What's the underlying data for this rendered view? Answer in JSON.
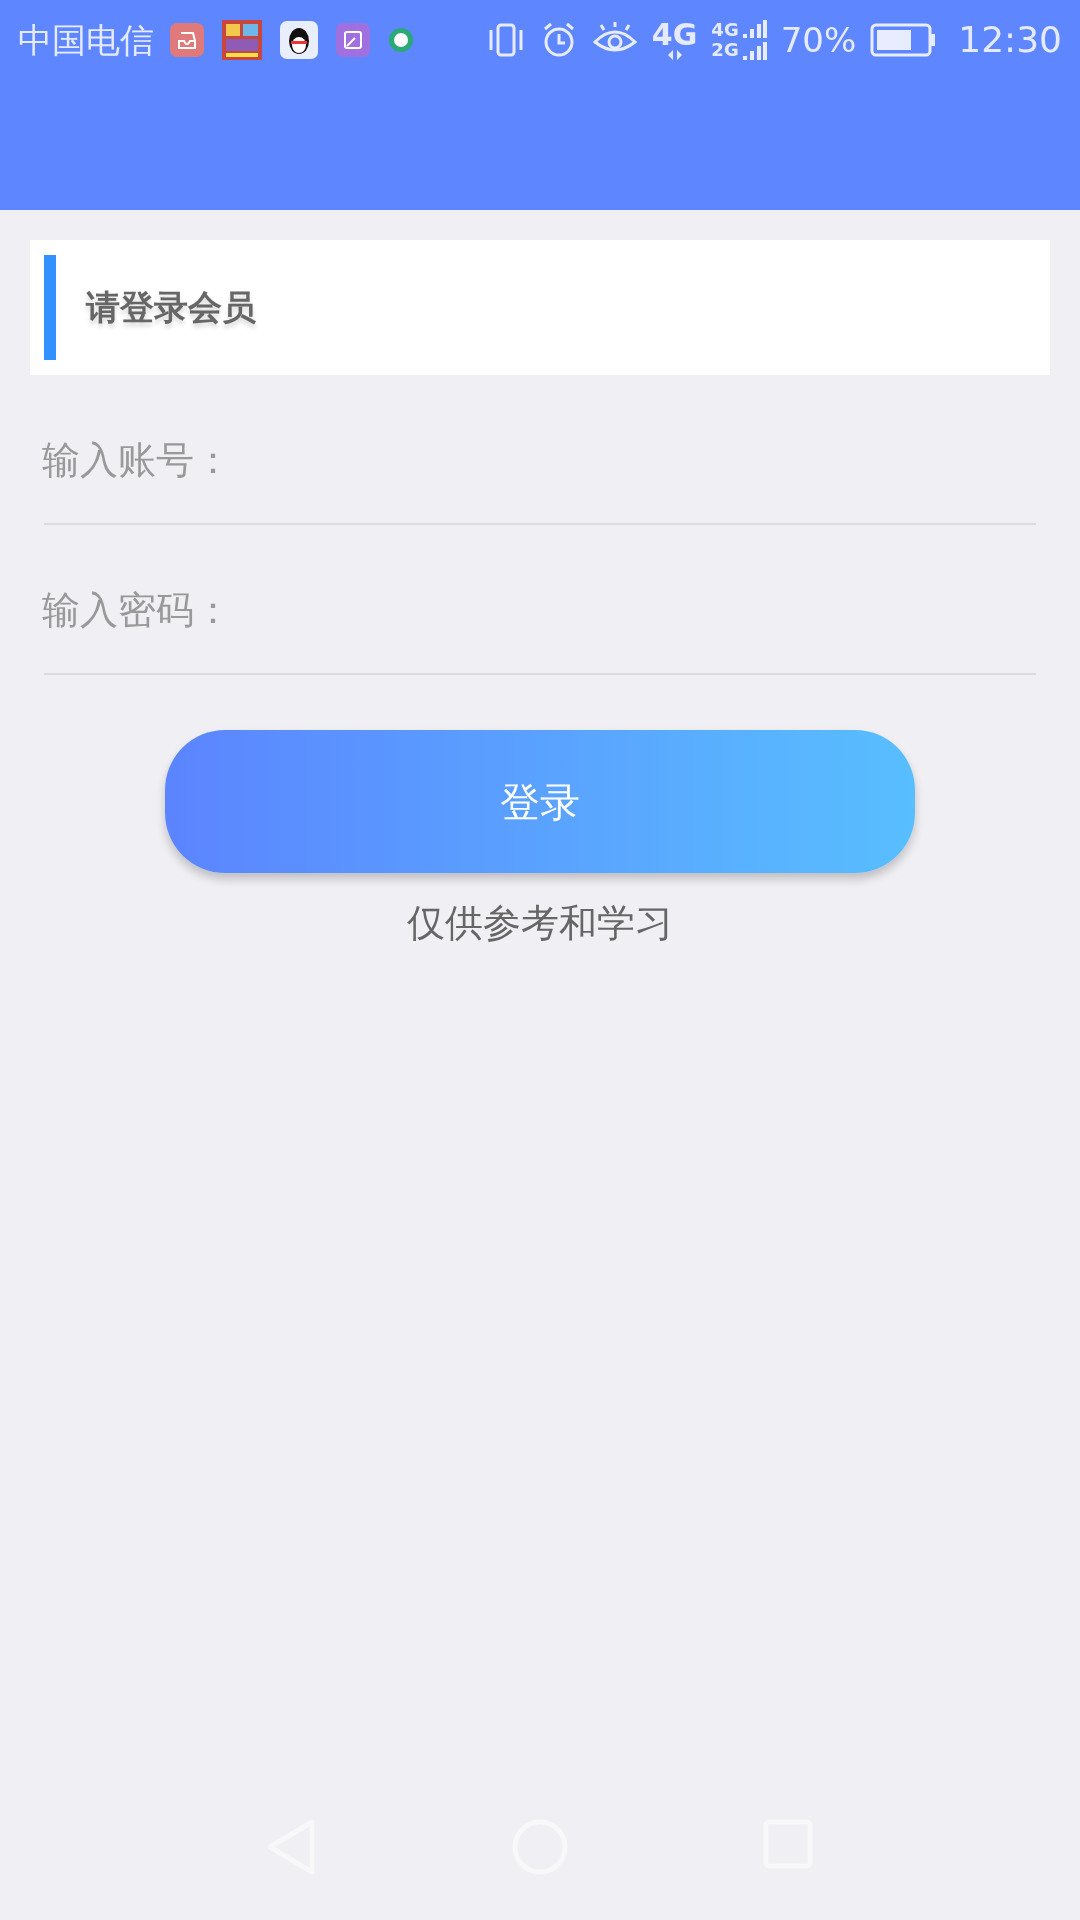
{
  "status_bar": {
    "carrier": "中国电信",
    "battery_percent": "70%",
    "time": "12:30",
    "network": "4G",
    "network_secondary": "4G",
    "network_tertiary": "2G"
  },
  "card": {
    "title": "请登录会员"
  },
  "fields": [
    {
      "label": "输入账号："
    },
    {
      "label": "输入密码："
    }
  ],
  "login_button": {
    "label": "登录"
  },
  "footer_note": "仅供参考和学习"
}
